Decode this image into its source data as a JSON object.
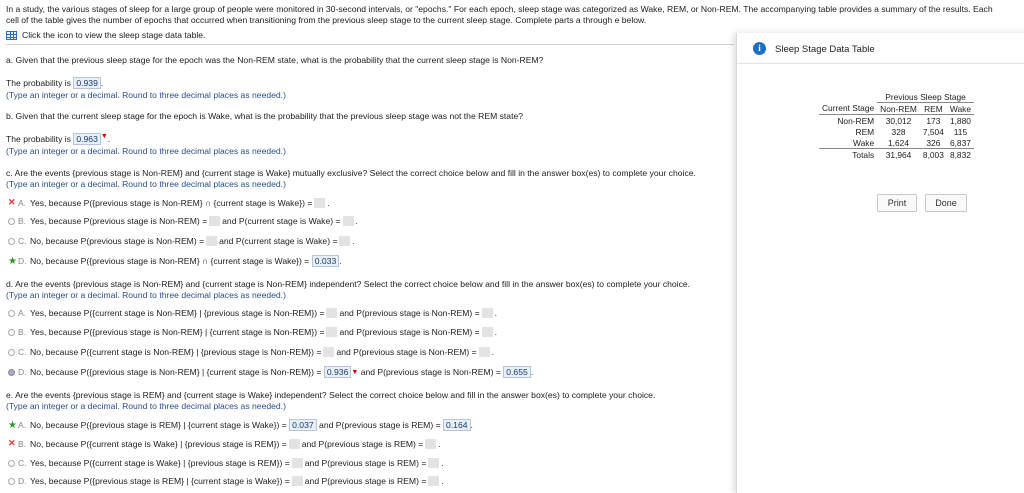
{
  "intro": "In a study, the various stages of sleep for a large group of people were monitored in 30-second intervals, or \"epochs.\" For each epoch, sleep stage was categorized as Wake, REM, or Non-REM. The accompanying table provides a summary of the results. Each cell of the table gives the number of epochs that occurred when transitioning from the previous sleep stage to the current sleep stage. Complete parts a through e below.",
  "data_link": "Click the icon to view the sleep stage data table.",
  "icons": {
    "table": "grid-icon",
    "info": "info-icon",
    "incorrect": "x-mark-icon",
    "correct": "star-check-icon"
  },
  "note": "(Type an integer or a decimal. Round to three decimal places as needed.)",
  "part_a": {
    "q": "a. Given that the previous sleep stage for the epoch was the Non-REM state, what is the probability that the current sleep stage is Non-REM?",
    "prefix": "The probability is",
    "answer": "0.939"
  },
  "part_b": {
    "q": "b. Given that the current sleep stage for the epoch is Wake, what is the probability that the previous sleep stage was not the REM state?",
    "prefix": "The probability is",
    "answer": "0.963"
  },
  "part_c": {
    "q": "c. Are the events {previous stage is Non-REM} and {current stage is Wake} mutually exclusive? Select the correct choice below and fill in the answer box(es) to complete your choice.",
    "opt_a": {
      "letter": "A.",
      "text": "Yes, because P({previous stage is Non-REM} ∩ {current stage is Wake}) ="
    },
    "opt_b": {
      "letter": "B.",
      "text1": "Yes, because P(previous stage is Non-REM) =",
      "text2": "and P(current stage is Wake) ="
    },
    "opt_c": {
      "letter": "C.",
      "text1": "No, because P(previous stage is Non-REM) =",
      "text2": "and P(current stage is Wake) ="
    },
    "opt_d": {
      "letter": "D.",
      "text": "No, because P({previous stage is Non-REM} ∩ {current stage is Wake}) =",
      "answer": "0.033"
    }
  },
  "part_d": {
    "q": "d. Are the events {previous stage is Non-REM} and {current stage is Non-REM} independent? Select the correct choice below and fill in the answer box(es) to complete your choice.",
    "opt_a": {
      "letter": "A.",
      "text1": "Yes, because P({current stage is Non-REM} | {previous stage is Non-REM}) =",
      "text2": "and P(previous stage is Non-REM) ="
    },
    "opt_b": {
      "letter": "B.",
      "text1": "Yes, because P({previous stage is Non-REM} | {current stage is Non-REM}) =",
      "text2": "and P(previous stage is Non-REM) ="
    },
    "opt_c": {
      "letter": "C.",
      "text1": "No, because P({current stage is Non-REM} | {previous stage is Non-REM}) =",
      "text2": "and P(previous stage is Non-REM) ="
    },
    "opt_d": {
      "letter": "D.",
      "text1": "No, because P({previous stage is Non-REM} | {current stage is Non-REM}) =",
      "answer1": "0.936",
      "text2": "and P(previous stage is Non-REM) =",
      "answer2": "0.655"
    }
  },
  "part_e": {
    "q": "e. Are the events {previous stage is REM} and {current stage is Wake} independent? Select the correct choice below and fill in the answer box(es) to complete your choice.",
    "opt_a": {
      "letter": "A.",
      "text1": "No, because P({previous stage is REM} | {current stage is Wake}) =",
      "answer1": "0.037",
      "text2": "and P(previous stage is REM) =",
      "answer2": "0.164"
    },
    "opt_b": {
      "letter": "B.",
      "text1": "No, because P({current stage is Wake} | {previous stage is REM}) =",
      "text2": "and P(previous stage is REM) ="
    },
    "opt_c": {
      "letter": "C.",
      "text1": "Yes, because P({current stage is Wake} | {previous stage is REM}) =",
      "text2": "and P(previous stage is REM) ="
    },
    "opt_d": {
      "letter": "D.",
      "text1": "Yes, because P({previous stage is REM} | {current stage is Wake}) =",
      "text2": "and P(previous stage is REM) ="
    }
  },
  "panel": {
    "title": "Sleep Stage Data Table",
    "table": {
      "group_header": "Previous Sleep Stage",
      "corner": "Current Stage",
      "columns": [
        "Non-REM",
        "REM",
        "Wake"
      ],
      "rows": [
        {
          "label": "Non-REM",
          "cells": [
            "30,012",
            "173",
            "1,880"
          ]
        },
        {
          "label": "REM",
          "cells": [
            "328",
            "7,504",
            "115"
          ]
        },
        {
          "label": "Wake",
          "cells": [
            "1,624",
            "326",
            "6,837"
          ]
        },
        {
          "label": "Totals",
          "cells": [
            "31,964",
            "8,003",
            "8,832"
          ]
        }
      ]
    },
    "print_label": "Print",
    "done_label": "Done"
  }
}
